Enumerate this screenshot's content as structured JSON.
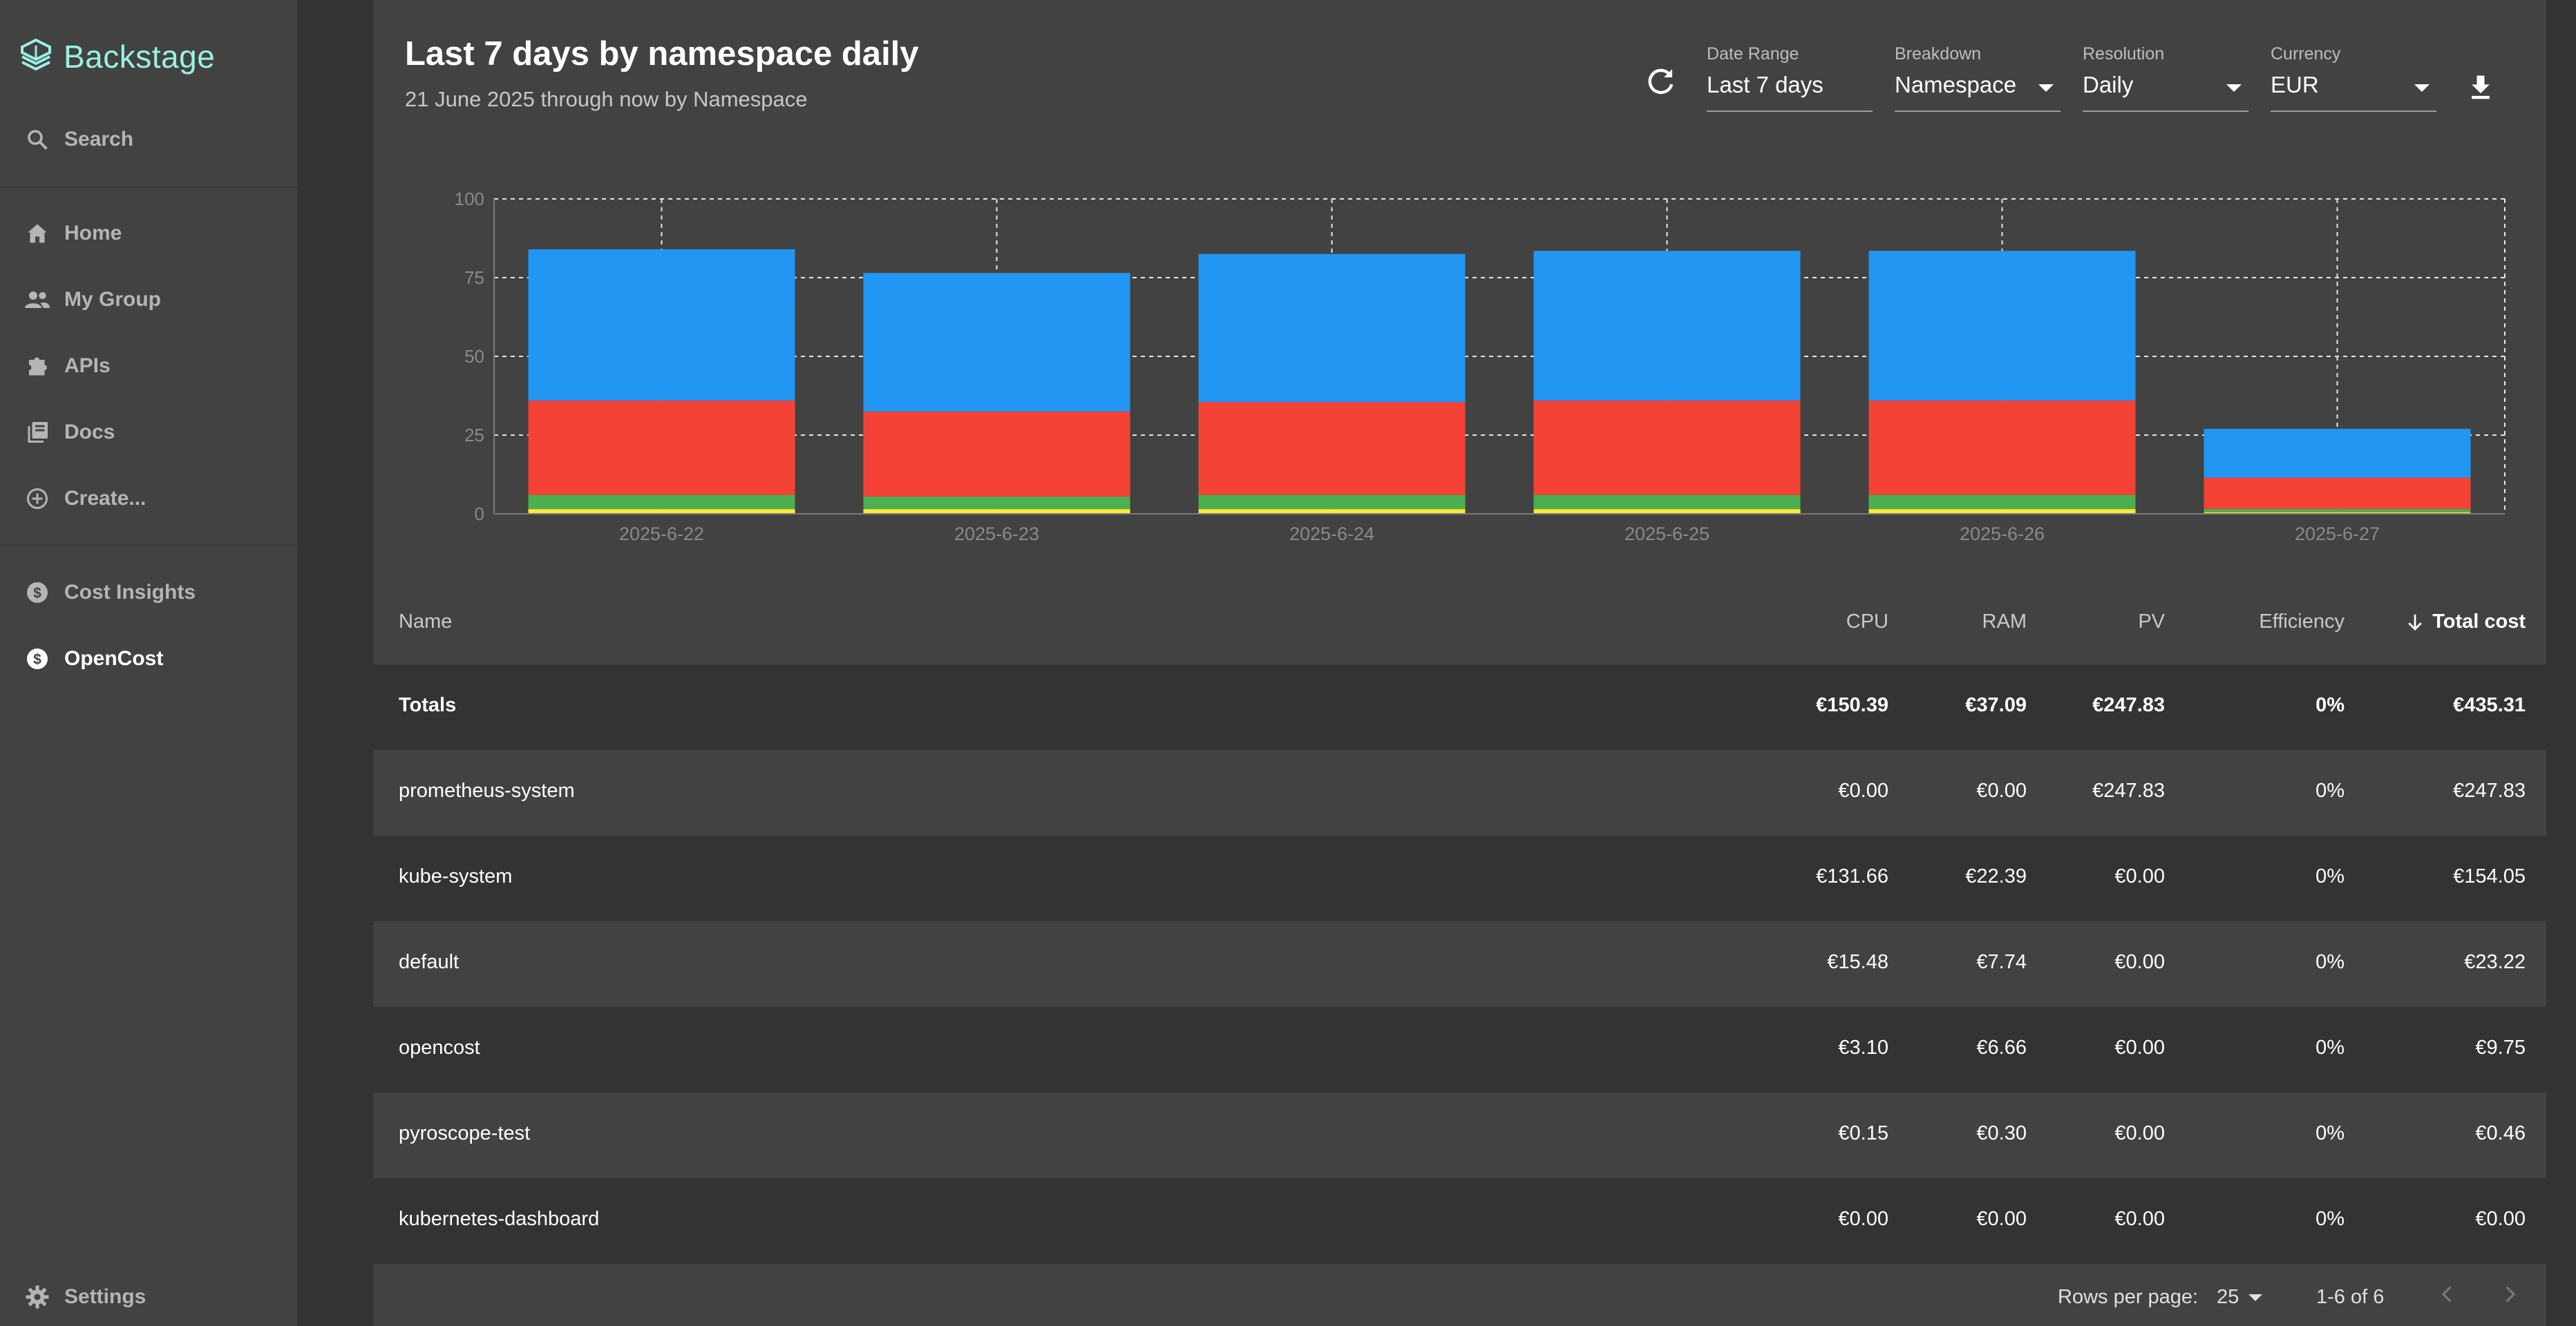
{
  "app": {
    "name": "Backstage"
  },
  "sidebar": {
    "search": "Search",
    "items": [
      {
        "label": "Home",
        "icon": "home-icon"
      },
      {
        "label": "My Group",
        "icon": "group-icon"
      },
      {
        "label": "APIs",
        "icon": "puzzle-icon"
      },
      {
        "label": "Docs",
        "icon": "library-icon"
      },
      {
        "label": "Create...",
        "icon": "add-circle-icon"
      }
    ],
    "plugins": [
      {
        "label": "Cost Insights",
        "icon": "dollar-icon"
      },
      {
        "label": "OpenCost",
        "icon": "dollar-icon",
        "active": true
      }
    ],
    "settings": "Settings"
  },
  "header": {
    "title": "Last 7 days by namespace daily",
    "subtitle": "21 June 2025 through now by Namespace"
  },
  "controls": {
    "date_range": {
      "label": "Date Range",
      "value": "Last 7 days"
    },
    "breakdown": {
      "label": "Breakdown",
      "value": "Namespace"
    },
    "resolution": {
      "label": "Resolution",
      "value": "Daily"
    },
    "currency": {
      "label": "Currency",
      "value": "EUR"
    }
  },
  "colors": {
    "blue": "#2196F3",
    "red": "#F44336",
    "green": "#4CAF50",
    "yellow": "#FFEB3B",
    "accent": "#9BF0E1"
  },
  "chart_data": {
    "type": "bar",
    "stacked": true,
    "categories": [
      "2025-6-22",
      "2025-6-23",
      "2025-6-24",
      "2025-6-25",
      "2025-6-26",
      "2025-6-27"
    ],
    "ylim": [
      0,
      100
    ],
    "yticks": [
      0,
      25,
      50,
      75,
      100
    ],
    "grid": true,
    "series": [
      {
        "color": "#FFEB3B",
        "values": [
          1.5,
          1.5,
          1.5,
          1.5,
          1.5,
          0.5
        ]
      },
      {
        "color": "#4CAF50",
        "values": [
          4.5,
          4.0,
          4.5,
          4.5,
          4.5,
          1.0
        ]
      },
      {
        "color": "#F44336",
        "values": [
          30.0,
          27.0,
          29.5,
          30.0,
          30.0,
          10.0
        ]
      },
      {
        "color": "#2196F3",
        "values": [
          48.0,
          44.0,
          47.0,
          47.5,
          47.5,
          15.5
        ]
      }
    ]
  },
  "table": {
    "columns": [
      "Name",
      "CPU",
      "RAM",
      "PV",
      "Efficiency",
      "Total cost"
    ],
    "totals": [
      "Totals",
      "€150.39",
      "€37.09",
      "€247.83",
      "0%",
      "€435.31"
    ],
    "rows": [
      [
        "prometheus-system",
        "€0.00",
        "€0.00",
        "€247.83",
        "0%",
        "€247.83"
      ],
      [
        "kube-system",
        "€131.66",
        "€22.39",
        "€0.00",
        "0%",
        "€154.05"
      ],
      [
        "default",
        "€15.48",
        "€7.74",
        "€0.00",
        "0%",
        "€23.22"
      ],
      [
        "opencost",
        "€3.10",
        "€6.66",
        "€0.00",
        "0%",
        "€9.75"
      ],
      [
        "pyroscope-test",
        "€0.15",
        "€0.30",
        "€0.00",
        "0%",
        "€0.46"
      ],
      [
        "kubernetes-dashboard",
        "€0.00",
        "€0.00",
        "€0.00",
        "0%",
        "€0.00"
      ]
    ]
  },
  "pagination": {
    "rows_per_page_label": "Rows per page:",
    "rows_per_page": "25",
    "range": "1-6 of 6"
  }
}
